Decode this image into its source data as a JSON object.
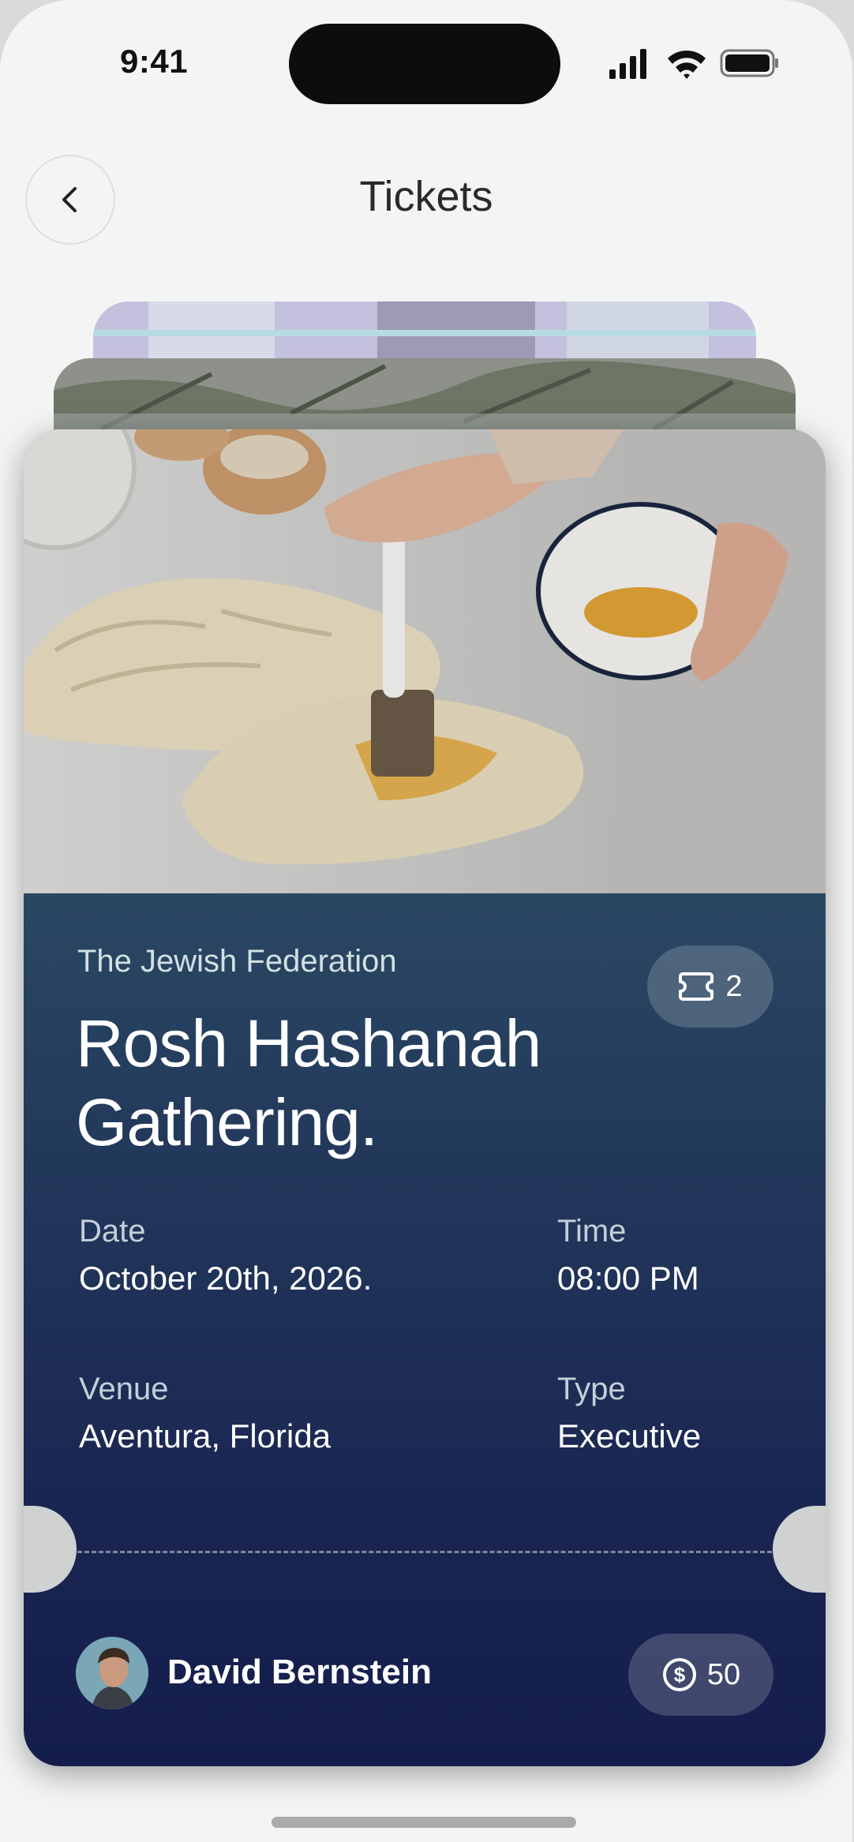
{
  "status_bar": {
    "time": "9:41"
  },
  "header": {
    "title": "Tickets"
  },
  "ticket": {
    "organizer": "The Jewish Federation",
    "title_line1": "Rosh Hashanah",
    "title_line2": "Gathering.",
    "ticket_count": "2",
    "date_label": "Date",
    "date_value": "October 20th, 2026.",
    "time_label": "Time",
    "time_value": "08:00 PM",
    "venue_label": "Venue",
    "venue_value": "Aventura, Florida",
    "type_label": "Type",
    "type_value": "Executive",
    "holder_name": "David Bernstein",
    "price": "50"
  },
  "icons": [
    "chevron-left-icon",
    "signal-icon",
    "wifi-icon",
    "battery-icon",
    "ticket-icon",
    "dollar-icon"
  ]
}
